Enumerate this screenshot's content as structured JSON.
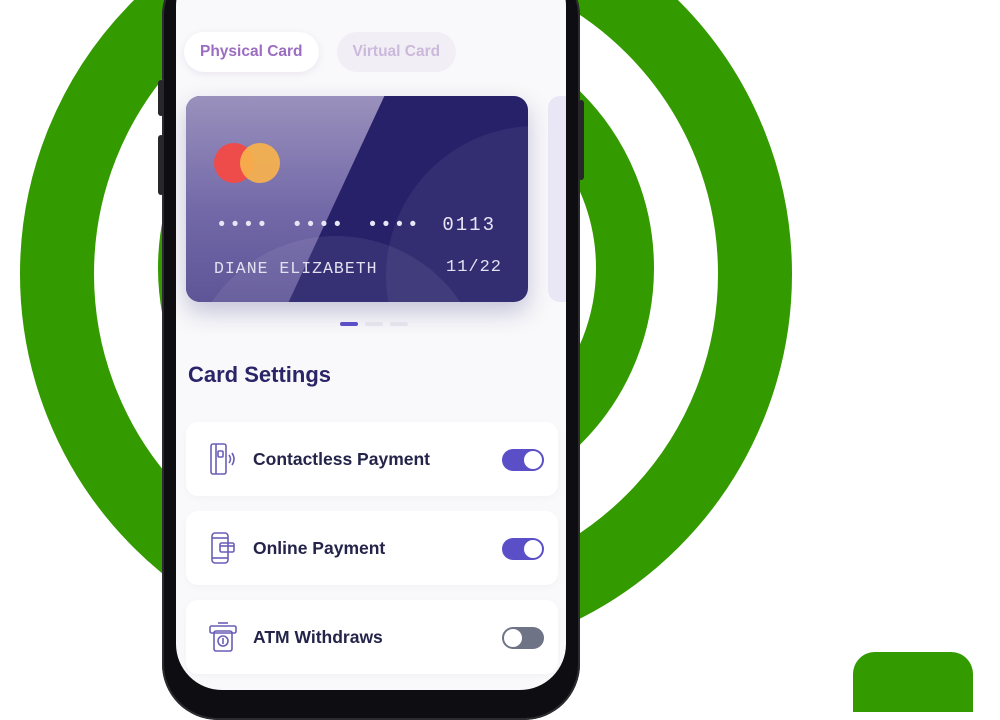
{
  "tabs": {
    "physical": "Physical Card",
    "virtual": "Virtual Card"
  },
  "card": {
    "number_groups": [
      "••••",
      "••••",
      "••••",
      "0113"
    ],
    "holder": "DIANE ELIZABETH",
    "expiry": "11/22",
    "brand_icon": "mastercard-icon"
  },
  "pagination": {
    "count": 3,
    "active": 1
  },
  "settings": {
    "title": "Card Settings",
    "items": [
      {
        "label": "Contactless Payment",
        "icon": "contactless-card-icon",
        "enabled": true
      },
      {
        "label": "Online Payment",
        "icon": "mobile-payment-icon",
        "enabled": true
      },
      {
        "label": "ATM Withdraws",
        "icon": "atm-withdraw-icon",
        "enabled": false
      }
    ]
  },
  "colors": {
    "accent": "#5b4fc7",
    "brand_green": "#339a00",
    "card_navy": "#27216a",
    "title_text": "#2a2468"
  }
}
